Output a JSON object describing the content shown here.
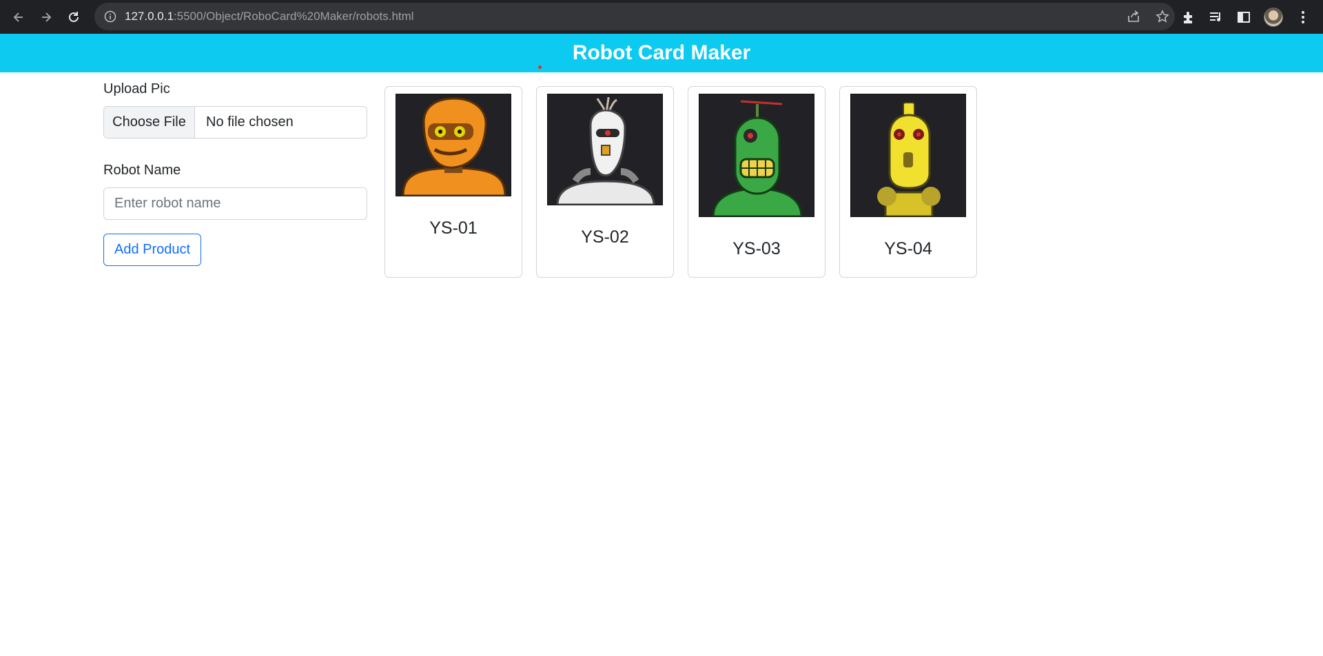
{
  "browser": {
    "url_host": "127.0.0.1",
    "url_rest": ":5500/Object/RoboCard%20Maker/robots.html"
  },
  "page": {
    "title": "Robot Card Maker"
  },
  "form": {
    "upload_label": "Upload Pic",
    "file_button_label": "Choose File",
    "file_status": "No file chosen",
    "name_label": "Robot Name",
    "name_placeholder": "Enter robot name",
    "add_button_label": "Add Product"
  },
  "cards": [
    {
      "name": "YS-01",
      "body_color": "#f0901e"
    },
    {
      "name": "YS-02",
      "body_color": "#e9e9e9"
    },
    {
      "name": "YS-03",
      "body_color": "#3aa845"
    },
    {
      "name": "YS-04",
      "body_color": "#f2e02f"
    }
  ],
  "icons": [
    "back-arrow-icon",
    "forward-arrow-icon",
    "reload-icon",
    "info-icon",
    "share-icon",
    "star-icon",
    "extensions-icon",
    "media-queue-icon",
    "side-panel-icon",
    "profile-avatar",
    "kebab-menu-icon"
  ]
}
